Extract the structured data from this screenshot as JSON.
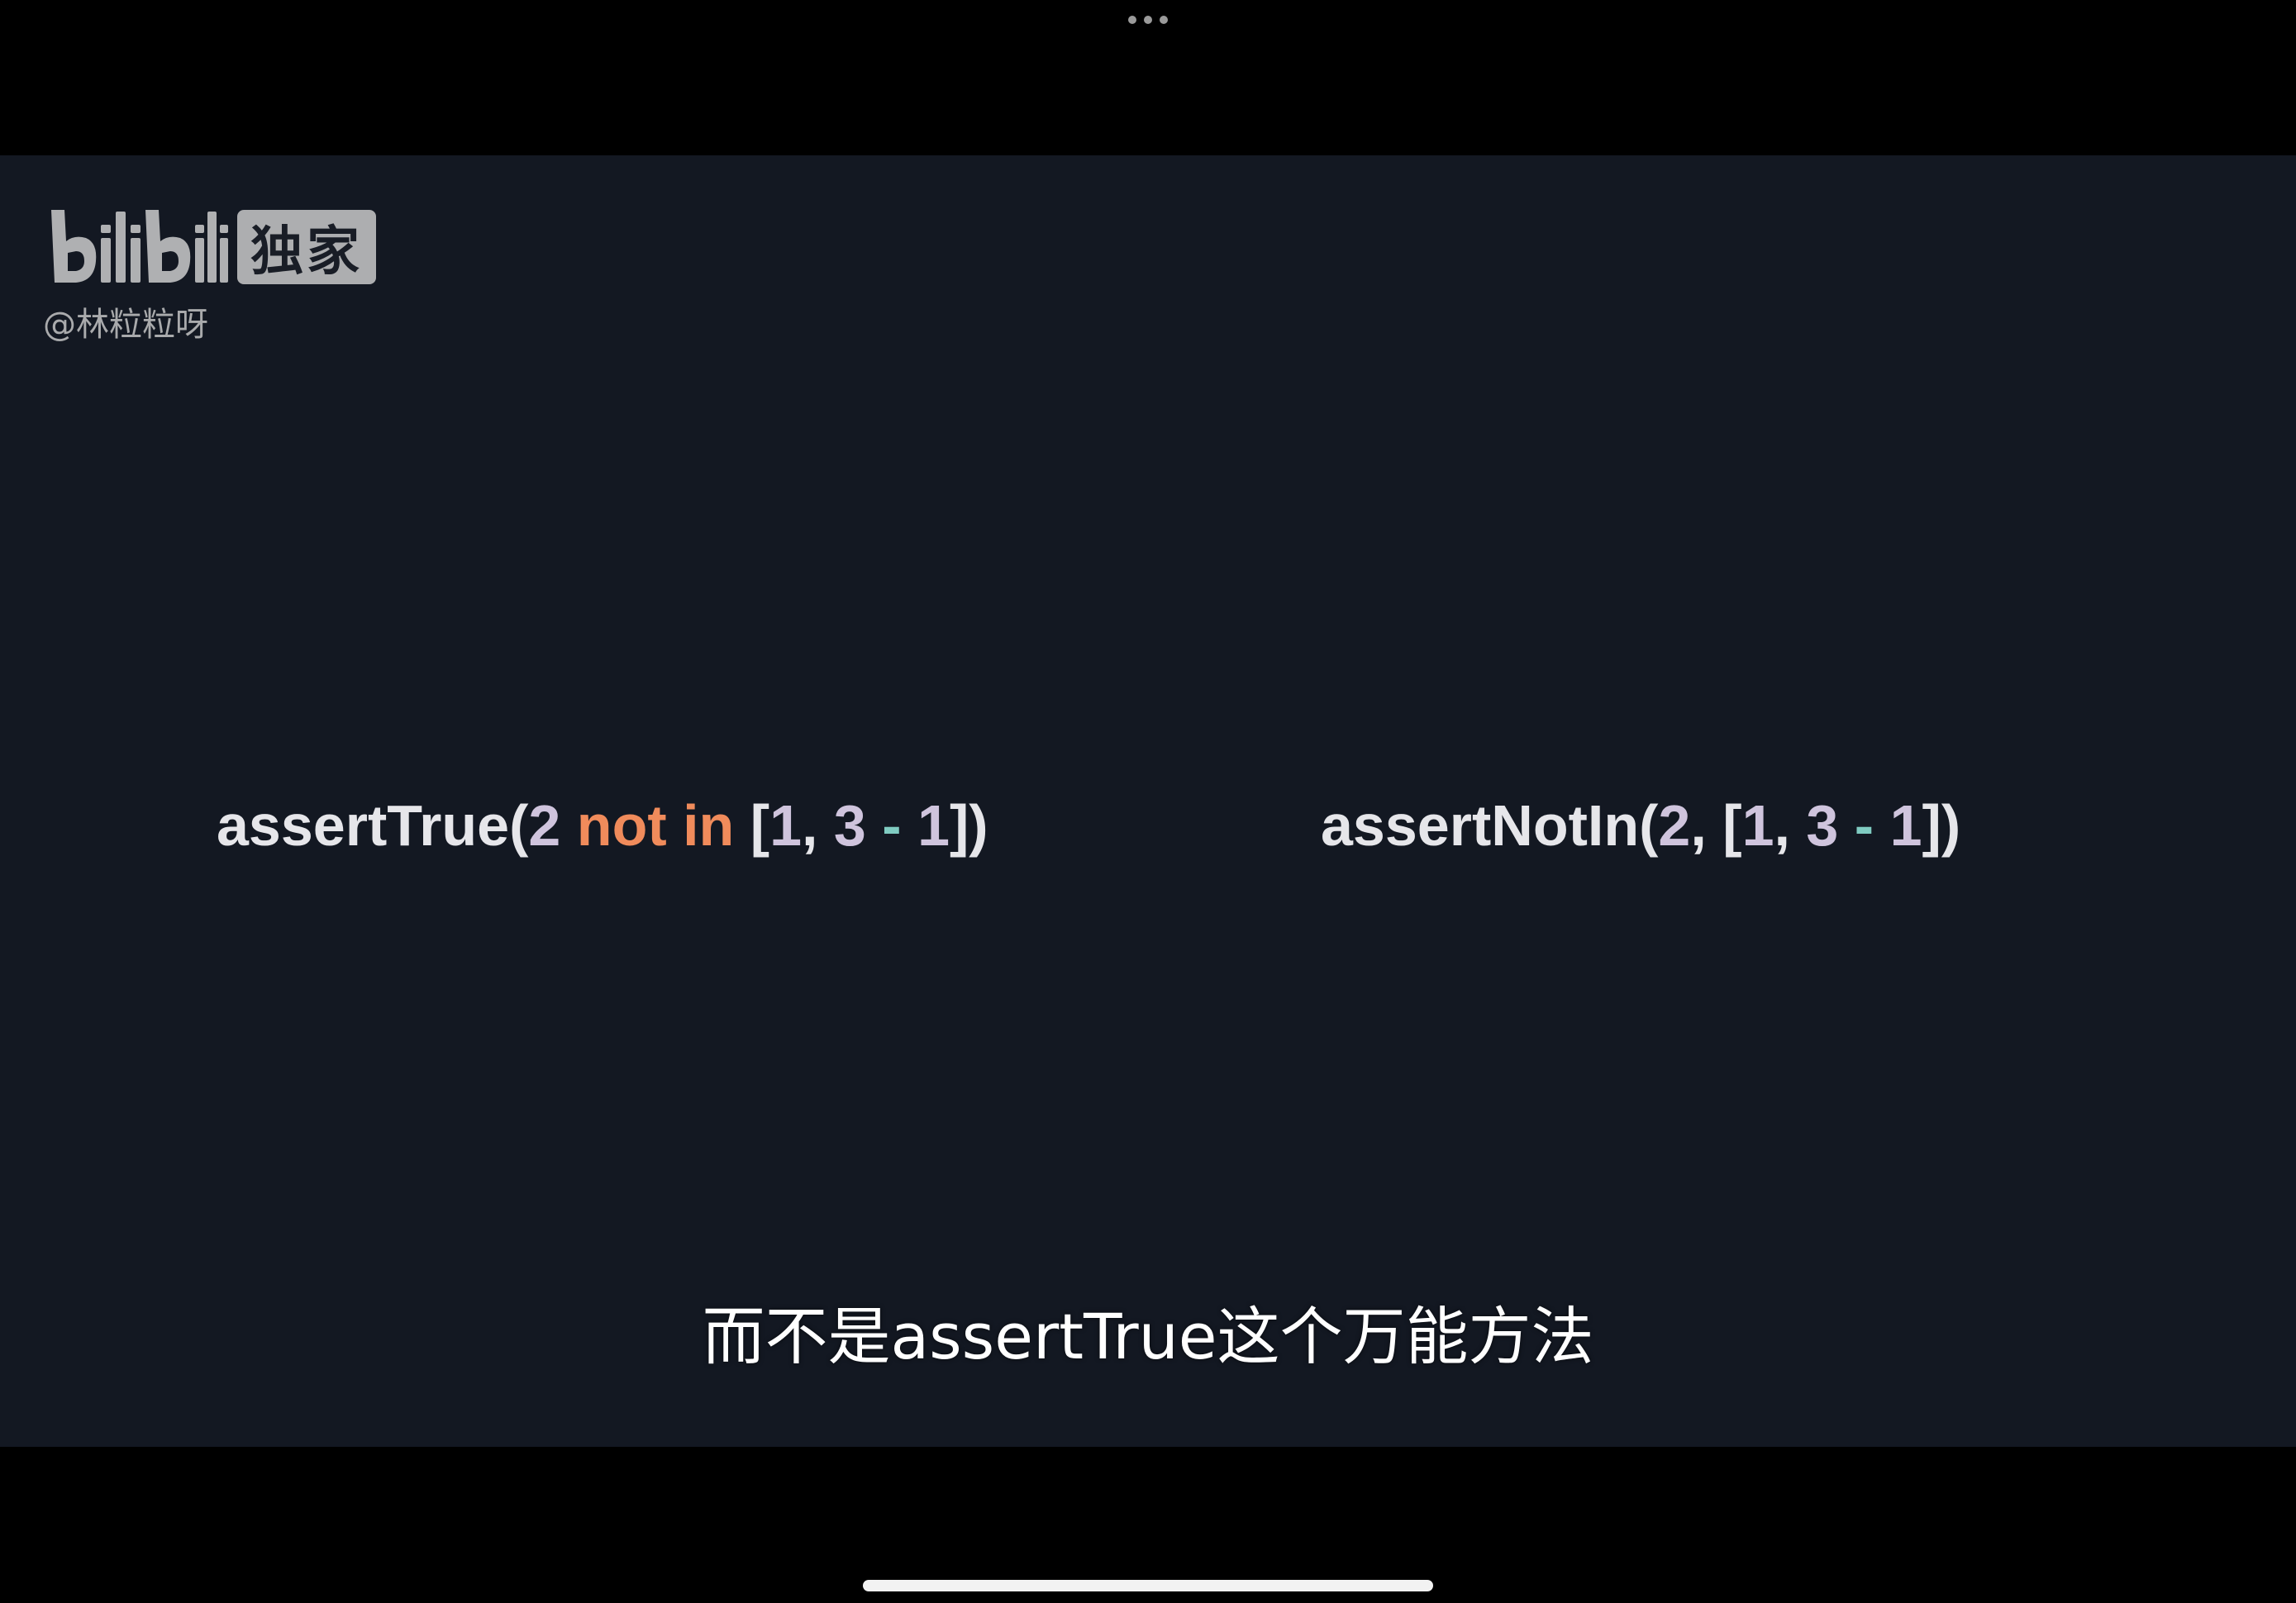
{
  "top_bar": {
    "more_icon": "ellipsis-icon"
  },
  "video": {
    "watermark": {
      "logo_text": "bilibili",
      "badge": "独家",
      "uploader": "@林粒粒呀"
    },
    "code_left": {
      "fn": "assertTrue(",
      "num1": "2",
      "kw": " not in ",
      "open": "[",
      "num2": "1",
      "comma": ", ",
      "num3": "3",
      "op": " - ",
      "num4": "1",
      "close": "])"
    },
    "code_right": {
      "fn": "assertNotIn(",
      "num1": "2",
      "sep": ", [",
      "num2": "1",
      "comma": ", ",
      "num3": "3",
      "op": " - ",
      "num4": "1",
      "close": "])"
    },
    "subtitle": "而不是assertTrue这个万能方法"
  },
  "colors": {
    "video_bg": "#131822",
    "keyword": "#f08b5b",
    "number": "#cfc4dd",
    "operator": "#7fcbc1",
    "plain": "#e6e6ea"
  }
}
